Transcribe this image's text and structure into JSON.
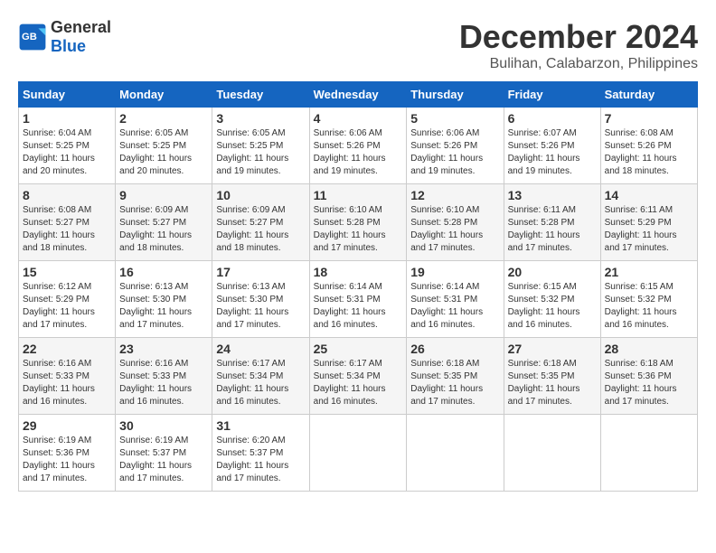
{
  "header": {
    "logo_general": "General",
    "logo_blue": "Blue",
    "month_title": "December 2024",
    "location": "Bulihan, Calabarzon, Philippines"
  },
  "days_of_week": [
    "Sunday",
    "Monday",
    "Tuesday",
    "Wednesday",
    "Thursday",
    "Friday",
    "Saturday"
  ],
  "weeks": [
    [
      {
        "day": "1",
        "sunrise": "6:04 AM",
        "sunset": "5:25 PM",
        "daylight": "11 hours and 20 minutes."
      },
      {
        "day": "2",
        "sunrise": "6:05 AM",
        "sunset": "5:25 PM",
        "daylight": "11 hours and 20 minutes."
      },
      {
        "day": "3",
        "sunrise": "6:05 AM",
        "sunset": "5:25 PM",
        "daylight": "11 hours and 19 minutes."
      },
      {
        "day": "4",
        "sunrise": "6:06 AM",
        "sunset": "5:26 PM",
        "daylight": "11 hours and 19 minutes."
      },
      {
        "day": "5",
        "sunrise": "6:06 AM",
        "sunset": "5:26 PM",
        "daylight": "11 hours and 19 minutes."
      },
      {
        "day": "6",
        "sunrise": "6:07 AM",
        "sunset": "5:26 PM",
        "daylight": "11 hours and 19 minutes."
      },
      {
        "day": "7",
        "sunrise": "6:08 AM",
        "sunset": "5:26 PM",
        "daylight": "11 hours and 18 minutes."
      }
    ],
    [
      {
        "day": "8",
        "sunrise": "6:08 AM",
        "sunset": "5:27 PM",
        "daylight": "11 hours and 18 minutes."
      },
      {
        "day": "9",
        "sunrise": "6:09 AM",
        "sunset": "5:27 PM",
        "daylight": "11 hours and 18 minutes."
      },
      {
        "day": "10",
        "sunrise": "6:09 AM",
        "sunset": "5:27 PM",
        "daylight": "11 hours and 18 minutes."
      },
      {
        "day": "11",
        "sunrise": "6:10 AM",
        "sunset": "5:28 PM",
        "daylight": "11 hours and 17 minutes."
      },
      {
        "day": "12",
        "sunrise": "6:10 AM",
        "sunset": "5:28 PM",
        "daylight": "11 hours and 17 minutes."
      },
      {
        "day": "13",
        "sunrise": "6:11 AM",
        "sunset": "5:28 PM",
        "daylight": "11 hours and 17 minutes."
      },
      {
        "day": "14",
        "sunrise": "6:11 AM",
        "sunset": "5:29 PM",
        "daylight": "11 hours and 17 minutes."
      }
    ],
    [
      {
        "day": "15",
        "sunrise": "6:12 AM",
        "sunset": "5:29 PM",
        "daylight": "11 hours and 17 minutes."
      },
      {
        "day": "16",
        "sunrise": "6:13 AM",
        "sunset": "5:30 PM",
        "daylight": "11 hours and 17 minutes."
      },
      {
        "day": "17",
        "sunrise": "6:13 AM",
        "sunset": "5:30 PM",
        "daylight": "11 hours and 17 minutes."
      },
      {
        "day": "18",
        "sunrise": "6:14 AM",
        "sunset": "5:31 PM",
        "daylight": "11 hours and 16 minutes."
      },
      {
        "day": "19",
        "sunrise": "6:14 AM",
        "sunset": "5:31 PM",
        "daylight": "11 hours and 16 minutes."
      },
      {
        "day": "20",
        "sunrise": "6:15 AM",
        "sunset": "5:32 PM",
        "daylight": "11 hours and 16 minutes."
      },
      {
        "day": "21",
        "sunrise": "6:15 AM",
        "sunset": "5:32 PM",
        "daylight": "11 hours and 16 minutes."
      }
    ],
    [
      {
        "day": "22",
        "sunrise": "6:16 AM",
        "sunset": "5:33 PM",
        "daylight": "11 hours and 16 minutes."
      },
      {
        "day": "23",
        "sunrise": "6:16 AM",
        "sunset": "5:33 PM",
        "daylight": "11 hours and 16 minutes."
      },
      {
        "day": "24",
        "sunrise": "6:17 AM",
        "sunset": "5:34 PM",
        "daylight": "11 hours and 16 minutes."
      },
      {
        "day": "25",
        "sunrise": "6:17 AM",
        "sunset": "5:34 PM",
        "daylight": "11 hours and 16 minutes."
      },
      {
        "day": "26",
        "sunrise": "6:18 AM",
        "sunset": "5:35 PM",
        "daylight": "11 hours and 17 minutes."
      },
      {
        "day": "27",
        "sunrise": "6:18 AM",
        "sunset": "5:35 PM",
        "daylight": "11 hours and 17 minutes."
      },
      {
        "day": "28",
        "sunrise": "6:18 AM",
        "sunset": "5:36 PM",
        "daylight": "11 hours and 17 minutes."
      }
    ],
    [
      {
        "day": "29",
        "sunrise": "6:19 AM",
        "sunset": "5:36 PM",
        "daylight": "11 hours and 17 minutes."
      },
      {
        "day": "30",
        "sunrise": "6:19 AM",
        "sunset": "5:37 PM",
        "daylight": "11 hours and 17 minutes."
      },
      {
        "day": "31",
        "sunrise": "6:20 AM",
        "sunset": "5:37 PM",
        "daylight": "11 hours and 17 minutes."
      },
      null,
      null,
      null,
      null
    ]
  ]
}
